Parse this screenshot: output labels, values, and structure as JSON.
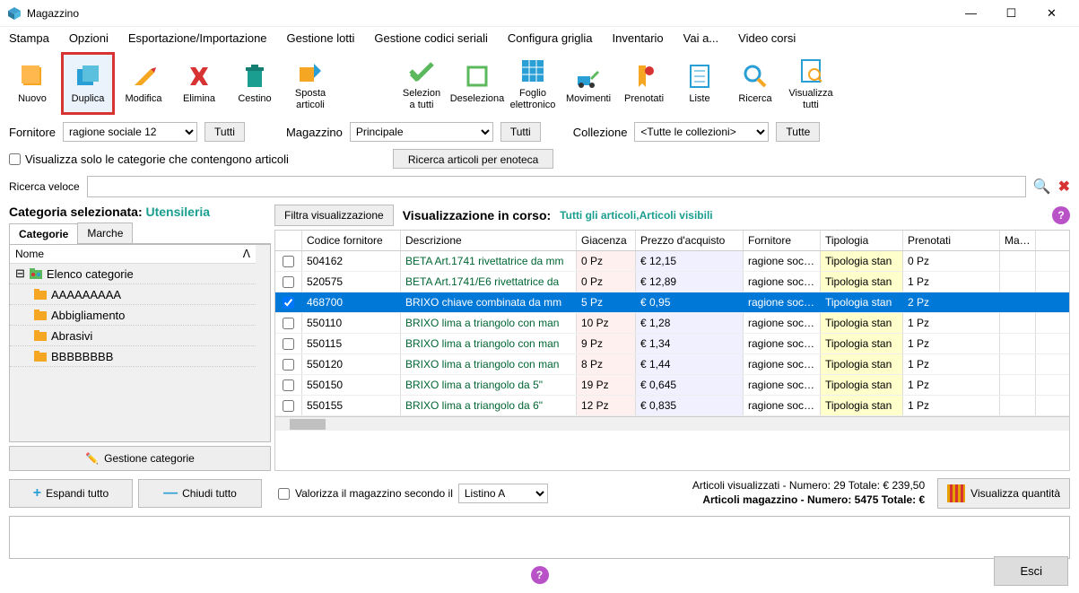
{
  "window": {
    "title": "Magazzino"
  },
  "menu": [
    "Stampa",
    "Opzioni",
    "Esportazione/Importazione",
    "Gestione lotti",
    "Gestione codici seriali",
    "Configura griglia",
    "Inventario",
    "Vai a...",
    "Video corsi"
  ],
  "toolbar": [
    {
      "id": "nuovo",
      "label": "Nuovo"
    },
    {
      "id": "duplica",
      "label": "Duplica",
      "hl": true
    },
    {
      "id": "modifica",
      "label": "Modifica"
    },
    {
      "id": "elimina",
      "label": "Elimina"
    },
    {
      "id": "cestino",
      "label": "Cestino"
    },
    {
      "id": "sposta",
      "label": "Sposta\narticoli"
    },
    {
      "id": "spacer"
    },
    {
      "id": "seleziona",
      "label": "Selezion\na tutti"
    },
    {
      "id": "deseleziona",
      "label": "Deseleziona"
    },
    {
      "id": "foglio",
      "label": "Foglio\nelettronico"
    },
    {
      "id": "movimenti",
      "label": "Movimenti"
    },
    {
      "id": "prenotati",
      "label": "Prenotati"
    },
    {
      "id": "liste",
      "label": "Liste"
    },
    {
      "id": "ricerca",
      "label": "Ricerca"
    },
    {
      "id": "visualizza",
      "label": "Visualizza\ntutti"
    }
  ],
  "filters": {
    "fornitore_label": "Fornitore",
    "fornitore_value": "ragione sociale 12",
    "fornitore_tutti": "Tutti",
    "magazzino_label": "Magazzino",
    "magazzino_value": "Principale",
    "magazzino_tutti": "Tutti",
    "collezione_label": "Collezione",
    "collezione_value": "<Tutte le collezioni>",
    "collezione_tutte": "Tutte"
  },
  "options": {
    "visualizza_solo": "Visualizza solo le categorie che contengono articoli",
    "ricerca_enoteca": "Ricerca articoli per enoteca"
  },
  "search": {
    "label": "Ricerca veloce",
    "value": ""
  },
  "category": {
    "label": "Categoria selezionata:",
    "value": "Utensileria"
  },
  "tabs": {
    "categorie": "Categorie",
    "marche": "Marche"
  },
  "tree": {
    "head": "Nome",
    "root": "Elenco categorie",
    "items": [
      "AAAAAAAAA",
      "Abbigliamento",
      "Abrasivi",
      "BBBBBBBB"
    ]
  },
  "gestione": "Gestione categorie",
  "viz": {
    "filter": "Filtra visualizzazione",
    "label": "Visualizzazione in corso:",
    "value": "Tutti gli articoli,Articoli visibili"
  },
  "grid": {
    "head": {
      "code": "Codice fornitore",
      "desc": "Descrizione",
      "giac": "Giacenza",
      "prezzo": "Prezzo d'acquisto",
      "forn": "Fornitore",
      "tip": "Tipologia",
      "pren": "Prenotati",
      "marche": "Marche"
    },
    "rows": [
      {
        "chk": false,
        "code": "504162",
        "desc": "BETA Art.1741 rivettatrice da mm",
        "giac": "0 Pz",
        "prezzo": "€ 12,15",
        "forn": "ragione sociale",
        "tip": "Tipologia stan",
        "pren": "0 Pz"
      },
      {
        "chk": false,
        "code": "520575",
        "desc": "BETA Art.1741/E6 rivettatrice da",
        "giac": "0 Pz",
        "prezzo": "€ 12,89",
        "forn": "ragione sociale",
        "tip": "Tipologia stan",
        "pren": "1 Pz"
      },
      {
        "chk": true,
        "sel": true,
        "code": "468700",
        "desc": "BRIXO chiave combinata da mm",
        "giac": "5 Pz",
        "prezzo": "€ 0,95",
        "forn": "ragione sociale",
        "tip": "Tipologia stan",
        "pren": "2 Pz"
      },
      {
        "chk": false,
        "code": "550110",
        "desc": "BRIXO lima a triangolo con man",
        "giac": "10 Pz",
        "prezzo": "€ 1,28",
        "forn": "ragione sociale",
        "tip": "Tipologia stan",
        "pren": "1 Pz"
      },
      {
        "chk": false,
        "code": "550115",
        "desc": "BRIXO lima a triangolo con man",
        "giac": "9 Pz",
        "prezzo": "€ 1,34",
        "forn": "ragione sociale",
        "tip": "Tipologia stan",
        "pren": "1 Pz"
      },
      {
        "chk": false,
        "code": "550120",
        "desc": "BRIXO lima a triangolo con man",
        "giac": "8 Pz",
        "prezzo": "€ 1,44",
        "forn": "ragione sociale",
        "tip": "Tipologia stan",
        "pren": "1 Pz"
      },
      {
        "chk": false,
        "code": "550150",
        "desc": "BRIXO lima a triangolo da 5\"",
        "giac": "19 Pz",
        "prezzo": "€ 0,645",
        "forn": "ragione sociale",
        "tip": "Tipologia stan",
        "pren": "1 Pz"
      },
      {
        "chk": false,
        "code": "550155",
        "desc": "BRIXO lima a triangolo da 6\"",
        "giac": "12 Pz",
        "prezzo": "€ 0,835",
        "forn": "ragione sociale",
        "tip": "Tipologia stan",
        "pren": "1 Pz"
      }
    ]
  },
  "expand": {
    "espandi": "Espandi tutto",
    "chiudi": "Chiudi tutto"
  },
  "valorizza": {
    "label": "Valorizza il magazzino secondo il",
    "value": "Listino A"
  },
  "stats": {
    "line1": "Articoli visualizzati - Numero: 29 Totale: € 239,50",
    "line2": "Articoli magazzino - Numero: 5475 Totale: €"
  },
  "qty": "Visualizza quantità",
  "esci": "Esci"
}
